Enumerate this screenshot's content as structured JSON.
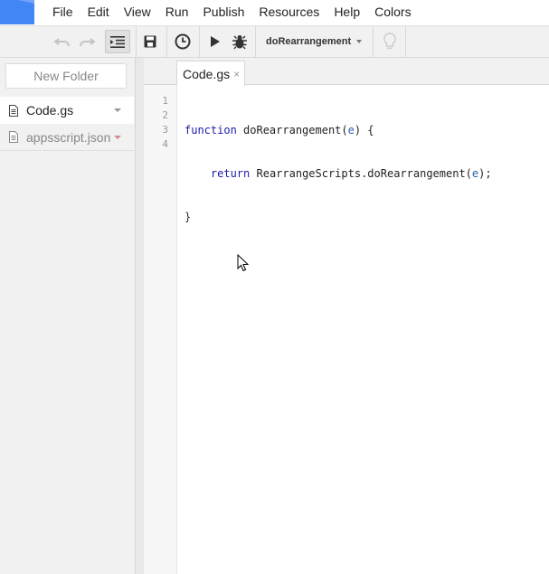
{
  "menubar": {
    "items": [
      "File",
      "Edit",
      "View",
      "Run",
      "Publish",
      "Resources",
      "Help",
      "Colors"
    ],
    "logo_icon": "apps-script-logo-icon",
    "accent_color": "#4285f4"
  },
  "toolbar": {
    "icons": [
      "undo-icon",
      "redo-icon",
      "indent-icon",
      "save-icon",
      "clock-trigger-icon",
      "run-icon",
      "debug-bug-icon",
      "lightbulb-icon"
    ],
    "function_select": "doRearrangement"
  },
  "sidebar": {
    "new_folder_label": "New Folder",
    "files": [
      {
        "name": "Code.gs",
        "selected": true
      },
      {
        "name": "appsscript.json",
        "selected": false
      }
    ]
  },
  "editor": {
    "tab_label": "Code.gs",
    "tab_close": "×",
    "line_numbers": [
      "1",
      "2",
      "3",
      "4"
    ],
    "code": {
      "l1_kw": "function",
      "l1_name": " doRearrangement(",
      "l1_param": "e",
      "l1_rest": ") {",
      "l2_indent": "    ",
      "l2_kw": "return",
      "l2_call": " RearrangeScripts.doRearrangement(",
      "l2_param": "e",
      "l2_rest": ");",
      "l3": "}",
      "l4": ""
    }
  }
}
